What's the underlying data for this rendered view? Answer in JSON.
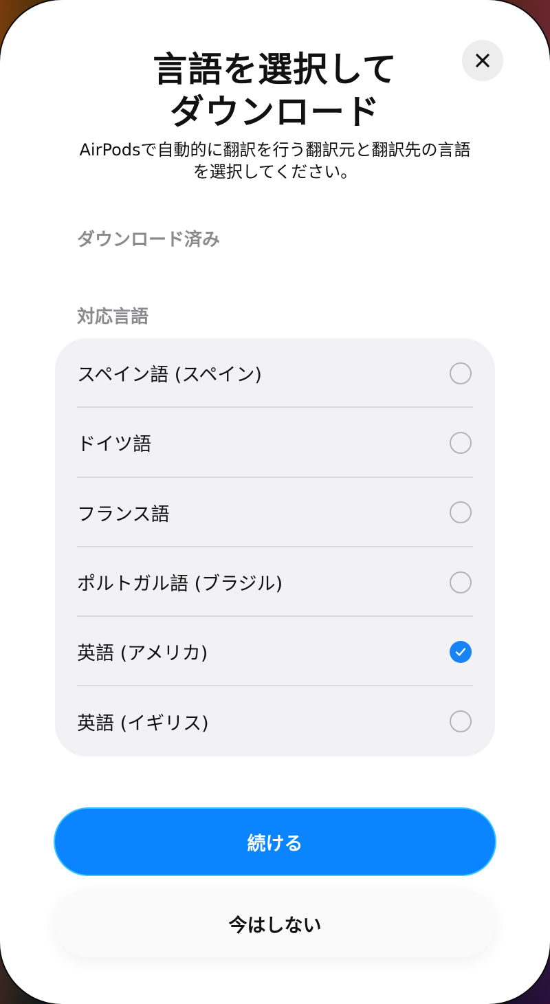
{
  "header": {
    "title_line1": "言語を選択して",
    "title_line2": "ダウンロード",
    "subtitle_line1": "AirPodsで自動的に翻訳を行う翻訳元と翻訳先の言語",
    "subtitle_line2": "を選択してください。",
    "close_icon": "close-icon"
  },
  "sections": {
    "downloaded_label": "ダウンロード済み",
    "supported_label": "対応言語"
  },
  "languages": [
    {
      "label": "スペイン語 (スペイン)",
      "selected": false
    },
    {
      "label": "ドイツ語",
      "selected": false
    },
    {
      "label": "フランス語",
      "selected": false
    },
    {
      "label": "ポルトガル語 (ブラジル)",
      "selected": false
    },
    {
      "label": "英語 (アメリカ)",
      "selected": true
    },
    {
      "label": "英語 (イギリス)",
      "selected": false
    }
  ],
  "actions": {
    "continue_label": "続ける",
    "not_now_label": "今はしない"
  },
  "colors": {
    "accent": "#0a84ff",
    "check": "#1783f6"
  }
}
